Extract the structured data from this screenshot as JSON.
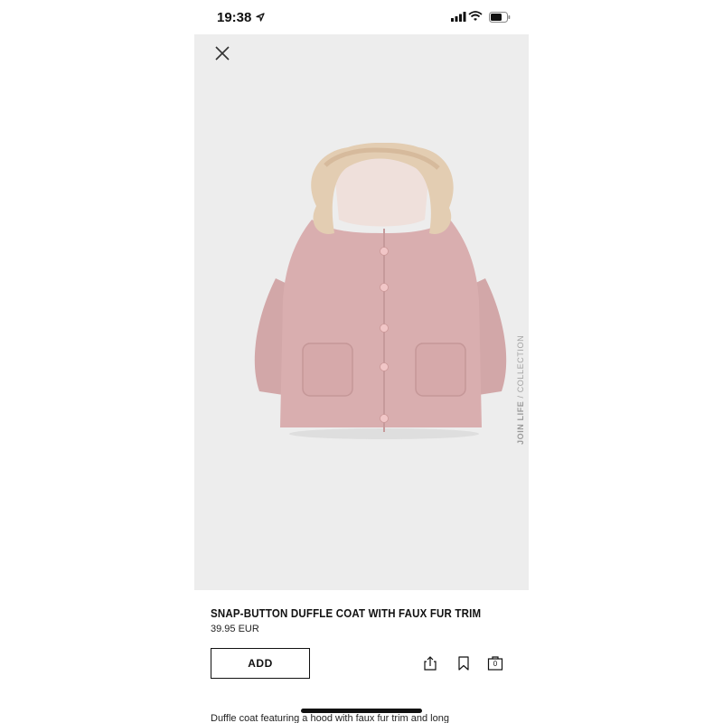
{
  "status_bar": {
    "time": "19:38",
    "icons": [
      "location-arrow-icon",
      "cellular-signal-icon",
      "wifi-icon",
      "battery-icon"
    ]
  },
  "product": {
    "image_icon": "coat-image",
    "side_label_bold": "JOIN LIFE",
    "side_label_rest": " / COLLECTION",
    "title": "SNAP-BUTTON DUFFLE COAT WITH FAUX FUR TRIM",
    "price": "39.95 EUR",
    "add_label": "ADD",
    "description": "Duffle coat featuring a hood with faux fur trim and long"
  },
  "actions": {
    "icons": [
      "close-icon",
      "share-icon",
      "bookmark-icon",
      "bag-icon"
    ],
    "bag_count": "0"
  },
  "colors": {
    "background": "#ededed",
    "coat_pink": "#d9aeaf",
    "fur": "#e3cdb2",
    "text": "#111111"
  }
}
